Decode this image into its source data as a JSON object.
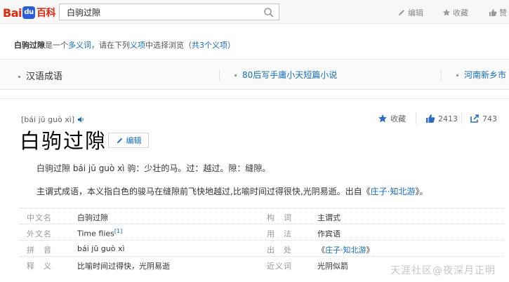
{
  "header": {
    "logo_text_a": "Bai",
    "logo_text_du": "du",
    "logo_text_baike": "百科",
    "search_value": "白驹过隙",
    "edit_label": "编辑",
    "favorite_label": "收藏",
    "like_label": "赞"
  },
  "disambiguation": {
    "term": "白驹过隙",
    "text_is": "是一个",
    "polysemy_link": "多义词",
    "text_choose": "，请在下列",
    "sense_link": "义项",
    "text_browse": "中选择浏览（",
    "total_link": "共3个义项",
    "text_end": "）"
  },
  "senses": [
    {
      "label": "汉语成语"
    },
    {
      "label": "80后写手庸小天短篇小说"
    },
    {
      "label": "河南新乡市"
    }
  ],
  "entry": {
    "pinyin": "[bái jū guò xì]",
    "title": "白驹过隙",
    "edit_button": "编辑",
    "favorite_label": "收藏",
    "like_count": "2413",
    "share_count": "743",
    "definition": "白驹过隙 bái jū guò xì 驹：少壮的马。过：越过。隙：缝隙。",
    "para2_text": "主谓式成语，本义指白色的骏马在缝隙前飞快地越过,比喻时间过得很快,光阴易逝。出自《",
    "para2_link": "庄子·知北游",
    "para2_end": "》。"
  },
  "info": [
    {
      "k1": "中文名",
      "v1": "白驹过隙",
      "k2": "构　词",
      "v2": "主谓式"
    },
    {
      "k1": "外文名",
      "v1": "Time flies",
      "ref": "[1]",
      "k2": "用　法",
      "v2": "作宾语"
    },
    {
      "k1": "拼　音",
      "v1": "bái jū guò xì",
      "k2": "出　处",
      "v2_pre": "《",
      "v2_link": "庄子·知北游",
      "v2_post": "》"
    },
    {
      "k1": "释　义",
      "v1": "比喻时间过得快，光阴易逝",
      "k2": "近义词",
      "v2": "光阴似箭"
    }
  ],
  "watermark": "天涯社区@夜深月正明",
  "colors": {
    "link": "#136ec2",
    "logo_red": "#de2910",
    "logo_blue": "#2b5fd9"
  }
}
